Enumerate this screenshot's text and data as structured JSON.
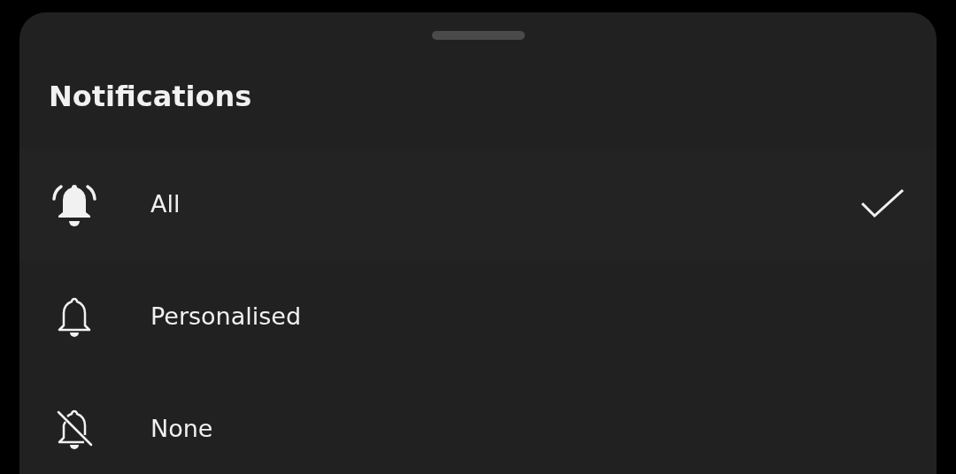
{
  "sheet": {
    "title": "Notifications"
  },
  "options": [
    {
      "kind": "ringing",
      "label": "All",
      "selected": true
    },
    {
      "kind": "outline",
      "label": "Personalised",
      "selected": false
    },
    {
      "kind": "off",
      "label": "None",
      "selected": false
    }
  ]
}
